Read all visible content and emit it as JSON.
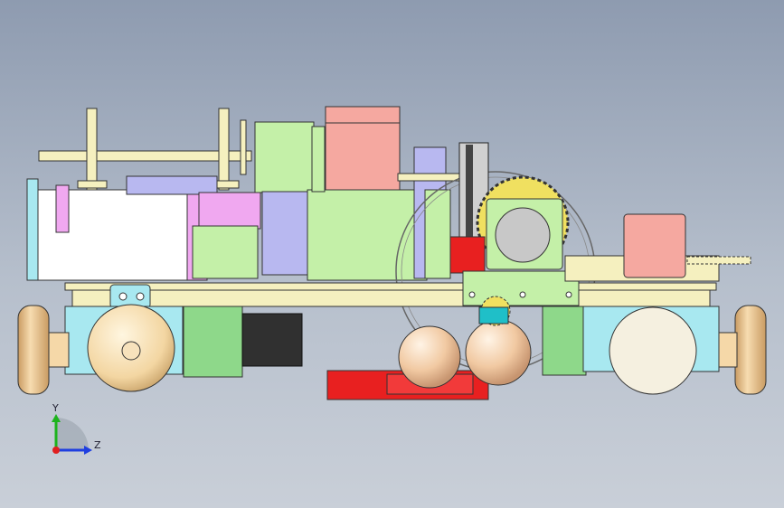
{
  "triad": {
    "y_label": "Y",
    "z_label": "Z",
    "colors": {
      "y": "#1db31d",
      "z": "#1f3fe0",
      "x": "#e01f1f"
    }
  },
  "part_colors": {
    "frame": "#f5f0bf",
    "housing_green": "#c4f0a8",
    "bright_green": "#8ed88a",
    "cyan": "#a8e8f0",
    "pink": "#f5a8a0",
    "violet": "#b8b8f0",
    "magenta": "#f0a8f0",
    "red": "#e82020",
    "gear_yellow": "#f0e060",
    "wheel_tan": "#f5d8a8",
    "motor_black": "#303030",
    "white": "#ffffff"
  }
}
